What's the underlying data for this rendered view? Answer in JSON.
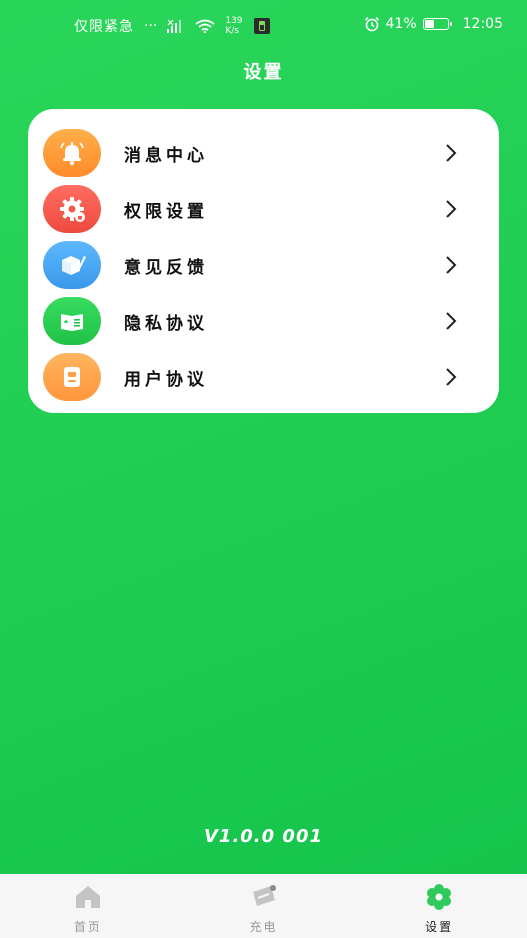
{
  "status_bar": {
    "carrier": "仅限紧急",
    "more": "···",
    "net_speed_value": "139",
    "net_speed_unit": "K/s",
    "battery_percent": "41%",
    "battery_level": 0.41,
    "time": "12:05"
  },
  "page": {
    "title": "设置",
    "version": "V1.0.0 001"
  },
  "menu": {
    "items": [
      {
        "label": "消息中心",
        "icon": "bell-icon",
        "color": "#ff9b38"
      },
      {
        "label": "权限设置",
        "icon": "gear-icon",
        "color": "#f4574c"
      },
      {
        "label": "意见反馈",
        "icon": "feedback-icon",
        "color": "#44a7f3"
      },
      {
        "label": "隐私协议",
        "icon": "privacy-card-icon",
        "color": "#22cc4c"
      },
      {
        "label": "用户协议",
        "icon": "document-icon",
        "color": "#ffa64a"
      }
    ]
  },
  "bottom_nav": {
    "items": [
      {
        "label": "首页",
        "icon": "home-icon",
        "active": false
      },
      {
        "label": "充电",
        "icon": "charge-icon",
        "active": false
      },
      {
        "label": "设置",
        "icon": "settings-flower-icon",
        "active": true
      }
    ]
  },
  "colors": {
    "background": "#1ecb52",
    "accent": "#2fc95c",
    "nav_inactive": "#bfbfbf"
  }
}
